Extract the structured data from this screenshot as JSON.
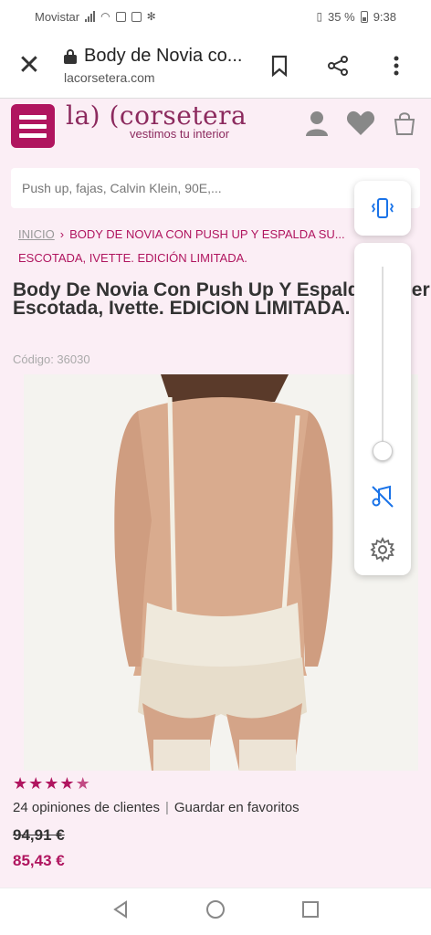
{
  "status_bar": {
    "carrier": "Movistar",
    "battery": "35 %",
    "time": "9:38"
  },
  "tab": {
    "title": "Body de Novia co...",
    "url": "lacorsetera.com",
    "close_icon": "close-icon",
    "bookmark_icon": "bookmark-icon",
    "share_icon": "share-icon",
    "menu_icon": "more-vert-icon"
  },
  "site": {
    "logo_main": "la) (corsetera",
    "logo_tagline": "vestimos tu interior",
    "brand_color": "#b0155f"
  },
  "search": {
    "placeholder": "Push up, fajas, Calvin Klein, 90E,..."
  },
  "breadcrumb": {
    "home": "INICIO",
    "current": "BODY DE NOVIA CON PUSH UP Y ESPALDA SU... ESCOTADA, IVETTE. EDICIÓN LIMITADA."
  },
  "product": {
    "title": "Body De Novia Con Push Up Y Espalda Super Escotada, Ivette. EDICION LIMITADA.",
    "code": "Código: 36030",
    "rating": 4.5,
    "reviews": "24 opiniones de clientes",
    "favorites": "Guardar en favoritos",
    "old_price": "94,91 €",
    "new_price": "85,43 €"
  },
  "volume": {
    "level": 0.04
  }
}
